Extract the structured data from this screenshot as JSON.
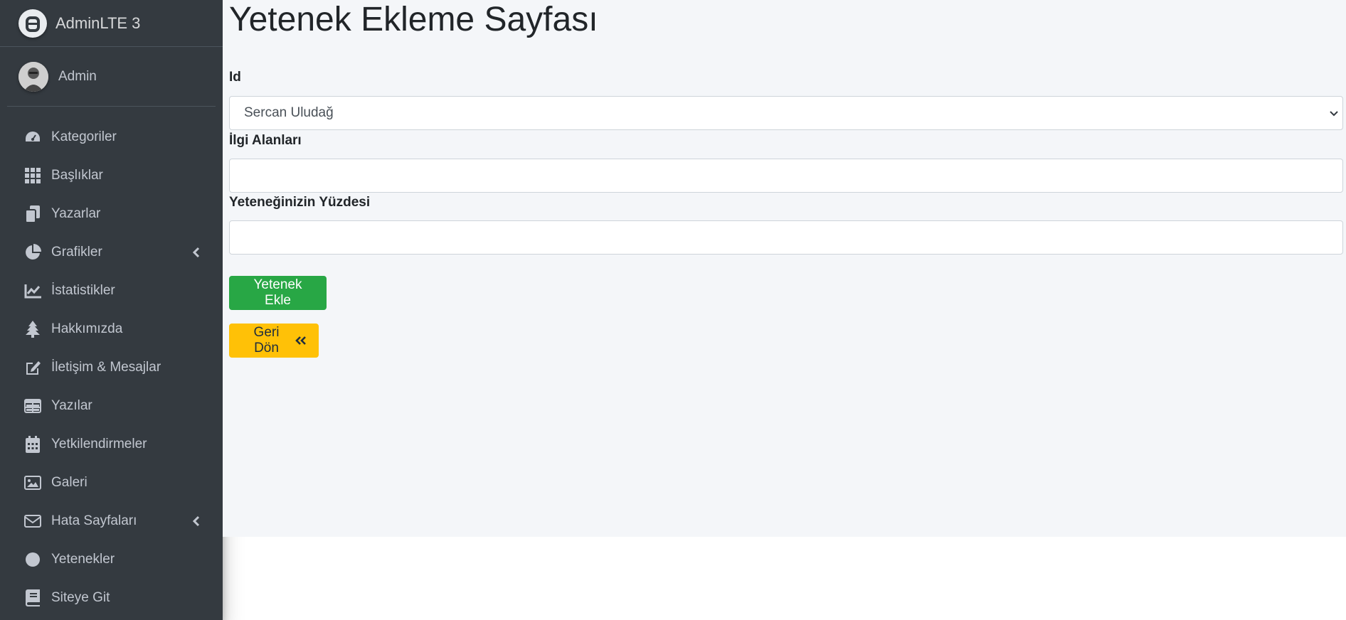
{
  "brand": {
    "name": "AdminLTE 3"
  },
  "user": {
    "name": "Admin"
  },
  "nav": {
    "items": [
      {
        "label": "Kategoriler",
        "icon": "tachometer-icon"
      },
      {
        "label": "Başlıklar",
        "icon": "grid-icon"
      },
      {
        "label": "Yazarlar",
        "icon": "copy-icon"
      },
      {
        "label": "Grafikler",
        "icon": "pie-chart-icon",
        "has_submenu": true
      },
      {
        "label": "İstatistikler",
        "icon": "line-chart-icon"
      },
      {
        "label": "Hakkımızda",
        "icon": "tree-icon"
      },
      {
        "label": "İletişim & Mesajlar",
        "icon": "edit-icon"
      },
      {
        "label": "Yazılar",
        "icon": "table-icon"
      },
      {
        "label": "Yetkilendirmeler",
        "icon": "calendar-icon"
      },
      {
        "label": "Galeri",
        "icon": "image-icon"
      },
      {
        "label": "Hata Sayfaları",
        "icon": "envelope-icon",
        "has_submenu": true
      },
      {
        "label": "Yetenekler",
        "icon": "circle-icon"
      },
      {
        "label": "Siteye Git",
        "icon": "book-icon"
      }
    ]
  },
  "page": {
    "title": "Yetenek Ekleme Sayfası",
    "form": {
      "id_label": "Id",
      "id_selected": "Sercan Uludağ",
      "interests_label": "İlgi Alanları",
      "interests_value": "",
      "percent_label": "Yeteneğinizin Yüzdesi",
      "percent_value": "",
      "submit_label": "Yetenek Ekle",
      "back_label": "Geri Dön"
    }
  },
  "colors": {
    "sidebar_bg": "#343a40",
    "content_bg": "#f4f6f9",
    "success": "#28a745",
    "warning": "#ffc107"
  }
}
